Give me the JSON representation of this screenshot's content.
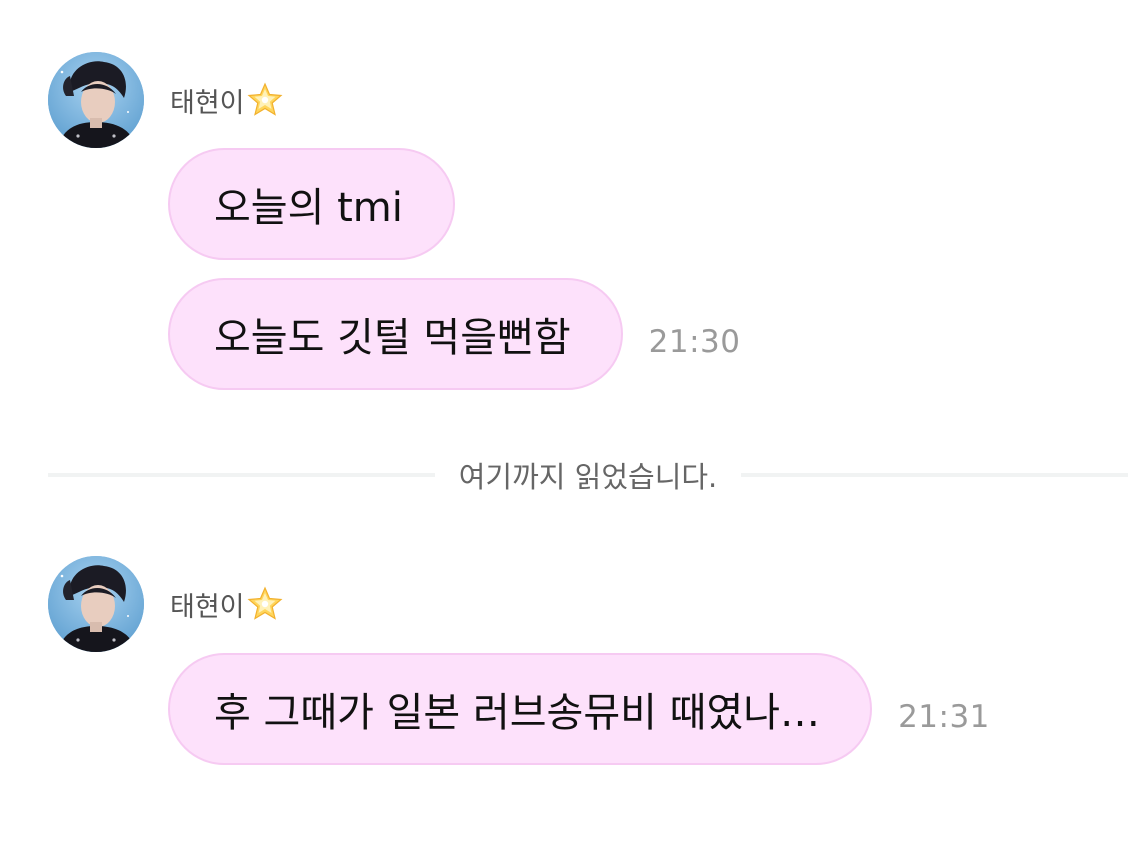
{
  "colors": {
    "bubble_bg": "#fde1fb",
    "bubble_border": "#f6caf2",
    "timestamp": "#9a9a9a",
    "sender_name": "#555555",
    "divider_line": "#f1f3f3"
  },
  "messages_before": {
    "sender": {
      "name": "태현이",
      "badge_icon": "glowing-star-icon",
      "avatar_icon": "profile-photo"
    },
    "bubbles": [
      {
        "text": "오늘의 tmi",
        "time": ""
      },
      {
        "text": "오늘도 깃털 먹을뻔함",
        "time": "21:30"
      }
    ]
  },
  "read_divider": {
    "label": "여기까지 읽었습니다."
  },
  "messages_after": {
    "sender": {
      "name": "태현이",
      "badge_icon": "glowing-star-icon",
      "avatar_icon": "profile-photo"
    },
    "bubbles": [
      {
        "text": "후 그때가 일본 러브송뮤비 때였나…",
        "time": "21:31"
      }
    ]
  }
}
